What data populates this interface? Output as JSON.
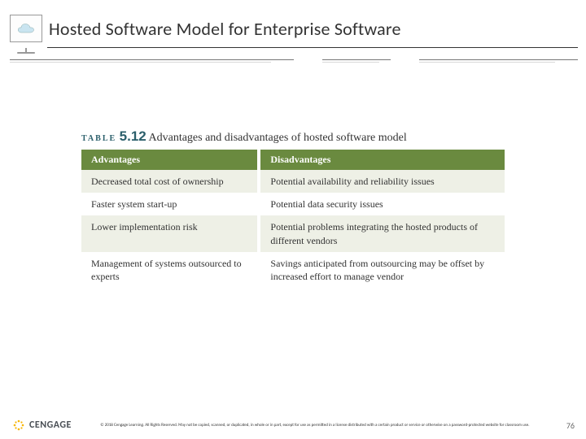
{
  "header": {
    "title": "Hosted Software Model for Enterprise Software"
  },
  "table": {
    "label_word": "TABLE",
    "number": "5.12",
    "caption": "Advantages and disadvantages of hosted software model",
    "headers": {
      "advantages": "Advantages",
      "disadvantages": "Disadvantages"
    },
    "rows": [
      {
        "adv": "Decreased total cost of ownership",
        "dis": "Potential availability and reliability issues"
      },
      {
        "adv": "Faster system start-up",
        "dis": "Potential data security issues"
      },
      {
        "adv": "Lower implementation risk",
        "dis": "Potential problems integrating the hosted products of different vendors"
      },
      {
        "adv": "Management of systems outsourced to experts",
        "dis": "Savings anticipated from outsourcing may be offset by increased effort to manage vendor"
      }
    ]
  },
  "footer": {
    "brand": "CENGAGE",
    "copyright": "© 2018 Cengage Learning. All Rights Reserved. May not be copied, scanned, or duplicated, in whole or in part, except for use as permitted in a license distributed with a certain product or service or otherwise on a password-protected website for classroom use.",
    "page": "76"
  }
}
